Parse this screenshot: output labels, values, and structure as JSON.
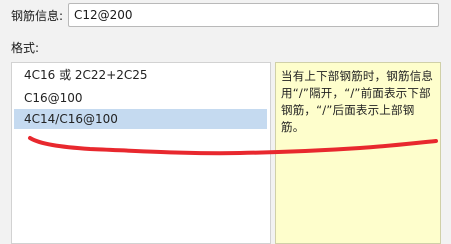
{
  "info_label": "钢筋信息:",
  "info_input": {
    "value": "C12@200"
  },
  "format_label": "格式:",
  "format_list": {
    "items": [
      {
        "label": "4C16 或 2C22+2C25",
        "selected": false
      },
      {
        "label": "C16@100",
        "selected": false
      },
      {
        "label": "4C14/C16@100",
        "selected": true
      }
    ]
  },
  "help_text": "当有上下部钢筋时，钢筋信息用“/”隔开，“/”前面表示下部钢筋，“/”后面表示上部钢筋。",
  "annotation_color": "#e8282e"
}
